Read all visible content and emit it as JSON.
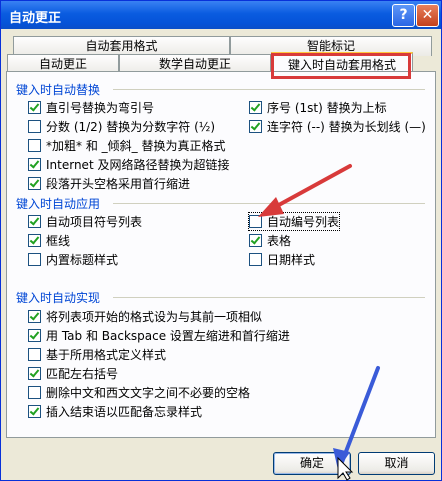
{
  "window": {
    "title": "自动更正"
  },
  "tabs_top": [
    "自动套用格式",
    "智能标记"
  ],
  "tabs_bottom": [
    "自动更正",
    "数学自动更正",
    "键入时自动套用格式"
  ],
  "groups": {
    "replace": "键入时自动替换",
    "apply": "键入时自动应用",
    "implement": "键入时自动实现"
  },
  "replace_left": [
    {
      "label": "直引号替换为弯引号",
      "checked": true
    },
    {
      "label": "分数 (1/2) 替换为分数字符 (½)",
      "checked": false
    },
    {
      "label": "*加粗* 和 _倾斜_ 替换为真正格式",
      "checked": false
    },
    {
      "label": "Internet 及网络路径替换为超链接",
      "checked": true
    },
    {
      "label": "段落开头空格采用首行缩进",
      "checked": true
    }
  ],
  "replace_right": [
    {
      "label": "序号 (1st) 替换为上标",
      "checked": true
    },
    {
      "label": "连字符 (--) 替换为长划线 (—)",
      "checked": true
    }
  ],
  "apply_left": [
    {
      "label": "自动项目符号列表",
      "checked": true
    },
    {
      "label": "框线",
      "checked": true
    },
    {
      "label": "内置标题样式",
      "checked": false
    }
  ],
  "apply_right": [
    {
      "label": "自动编号列表",
      "checked": false
    },
    {
      "label": "表格",
      "checked": true
    },
    {
      "label": "日期样式",
      "checked": false
    }
  ],
  "implement_list": [
    {
      "label": "将列表项开始的格式设为与其前一项相似",
      "checked": true
    },
    {
      "label": "用 Tab 和 Backspace 设置左缩进和首行缩进",
      "checked": true
    },
    {
      "label": "基于所用格式定义样式",
      "checked": false
    },
    {
      "label": "匹配左右括号",
      "checked": true
    },
    {
      "label": "删除中文和西文文字之间不必要的空格",
      "checked": false
    },
    {
      "label": "插入结束语以匹配备忘录样式",
      "checked": true
    }
  ],
  "buttons": {
    "ok": "确定",
    "cancel": "取消"
  },
  "colors": {
    "annotation_red": "#d83a3a",
    "annotation_blue": "#3a5bd8"
  }
}
